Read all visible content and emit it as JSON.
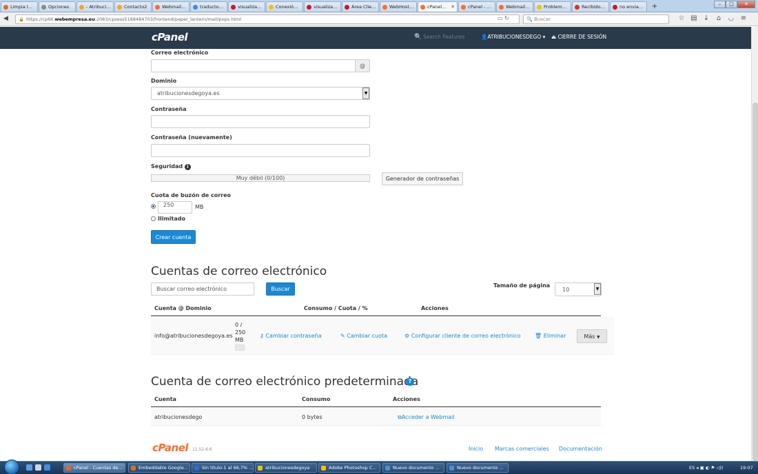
{
  "browser": {
    "tabs": [
      {
        "label": "Limpia la ...",
        "color": "#e06c1f"
      },
      {
        "label": "Opciones",
        "color": "#8a8a8a"
      },
      {
        "label": "- Atribuci...",
        "color": "#f4a623"
      },
      {
        "label": "Contacto2",
        "color": "#f4a623"
      },
      {
        "label": "Webmail ...",
        "color": "#ff6c2c"
      },
      {
        "label": "traductor ...",
        "color": "#4285f4"
      },
      {
        "label": "visualizaci...",
        "color": "#c7192e"
      },
      {
        "label": "Conexión ...",
        "color": "#f2c200"
      },
      {
        "label": "visualizaci...",
        "color": "#c7192e"
      },
      {
        "label": "Área Clie...",
        "color": "#c7192e"
      },
      {
        "label": "WebHost ...",
        "color": "#ff6c2c"
      },
      {
        "label": "cPanel...",
        "color": "#ff6c2c",
        "active": true
      },
      {
        "label": "cPanel - P...",
        "color": "#ff6c2c"
      },
      {
        "label": "Webmail ...",
        "color": "#ff6c2c"
      },
      {
        "label": "Problema...",
        "color": "#f2c200"
      },
      {
        "label": "Recibidos...",
        "color": "#d93025"
      },
      {
        "label": "no envia ...",
        "color": "#c7192e"
      }
    ],
    "url_scheme": "https://cp66.",
    "url_host": "webempresa.eu",
    "url_rest": ":2083/cpsess5168484703/frontend/paper_lantern/mail/pops.html",
    "search_placeholder": "Buscar"
  },
  "cpanel": {
    "logo": "cPanel",
    "search_placeholder": "Search Features",
    "user": "ATRIBUCIONESDEGO",
    "logout": "CIERRE DE SESIÓN"
  },
  "form": {
    "email_label": "Correo electrónico",
    "email_at": "@",
    "domain_label": "Dominio",
    "domain_value": "atribucionesdegoya.es",
    "password_label": "Contraseña",
    "password_repeat_label": "Contraseña (nuevamente)",
    "security_label": "Seguridad",
    "strength_text": "Muy débil (0/100)",
    "generator_button": "Generador de contraseñas",
    "quota_label": "Cuota de buzón de correo",
    "quota_value": "250",
    "quota_unit": "MB",
    "unlimited_label": "Ilimitado",
    "create_button": "Crear cuenta"
  },
  "accounts": {
    "title": "Cuentas de correo electrónico",
    "search_placeholder": "Buscar correo electrónico",
    "search_button": "Buscar",
    "page_size_label": "Tamaño de página",
    "page_size_value": "10",
    "columns": {
      "account": "Cuenta @ Dominio",
      "usage": "Consumo / Cuota / %",
      "actions": "Acciones"
    },
    "rows": [
      {
        "email": "info@atribucionesdegoya.es",
        "quota_used": "0 /",
        "quota_total": "250",
        "quota_unit": "MB",
        "change_password": "Cambiar contraseña",
        "change_quota": "Cambiar cuota",
        "configure_client": "Configurar cliente de correo electrónico",
        "delete": "Eliminar",
        "more": "Más"
      }
    ]
  },
  "default_account": {
    "title": "Cuenta de correo electrónico predeterminada",
    "columns": {
      "account": "Cuenta",
      "usage": "Consumo",
      "actions": "Acciones"
    },
    "row": {
      "account": "atribucionesdego",
      "usage": "0 bytes",
      "webmail": "Acceder a Webmail"
    }
  },
  "footer": {
    "logo": "cPanel",
    "version": "11.52.6.6",
    "links": [
      "Inicio",
      "Marcas comerciales",
      "Documentación"
    ]
  },
  "taskbar": {
    "items": [
      {
        "label": "cPanel - Cuentas de...",
        "color": "#e06c1f",
        "active": true
      },
      {
        "label": "Embeddable Google...",
        "color": "#e06c1f"
      },
      {
        "label": "Sin título-1 al 66,7% ...",
        "color": "#2b6fd1"
      },
      {
        "label": "atribucionesdegoya",
        "color": "#f2c200"
      },
      {
        "label": "Adobe Photoshop C...",
        "color": "#f2c200"
      },
      {
        "label": "Nuevo documento ...",
        "color": "#4a90d9"
      },
      {
        "label": "Nuevo documento ...",
        "color": "#4a90d9"
      }
    ],
    "lang": "ES",
    "clock": "19:07"
  },
  "colors": {
    "accent": "#1a88d5",
    "header": "#293a4a",
    "brand": "#ff6c2c"
  }
}
